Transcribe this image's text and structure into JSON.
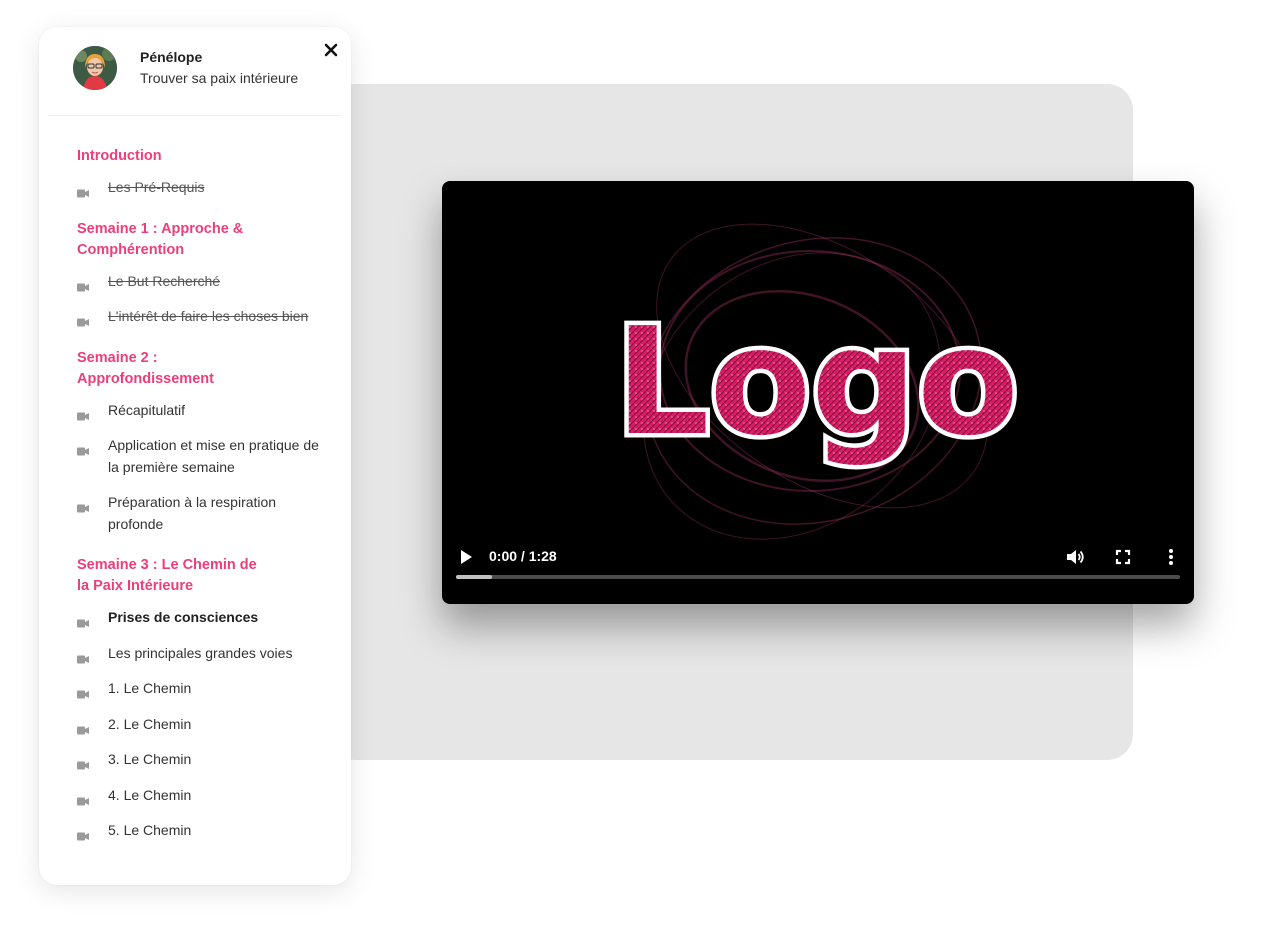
{
  "user": {
    "name": "Pénélope",
    "course_title": "Trouver sa paix intérieure"
  },
  "sections": [
    {
      "title": "Introduction",
      "lessons": [
        {
          "label": "Les Pré-Requis",
          "state": "done"
        }
      ]
    },
    {
      "title": "Semaine 1 : Approche & Comphérention",
      "lessons": [
        {
          "label": "Le But Recherché",
          "state": "done"
        },
        {
          "label": "L'intérêt de faire les choses bien",
          "state": "done"
        }
      ]
    },
    {
      "title": "Semaine 2 : Approfondissement",
      "lessons": [
        {
          "label": "Récapitulatif",
          "state": "normal"
        },
        {
          "label": "Application et mise en pratique de la première semaine",
          "state": "normal"
        },
        {
          "label": "Préparation à la respiration profonde",
          "state": "normal"
        }
      ]
    },
    {
      "title": "Semaine 3 : Le Chemin de la Paix Intérieure",
      "lessons": [
        {
          "label": "Prises de consciences",
          "state": "current"
        },
        {
          "label": "Les principales grandes voies",
          "state": "normal"
        },
        {
          "label": "1. Le Chemin",
          "state": "normal"
        },
        {
          "label": "2. Le Chemin",
          "state": "normal"
        },
        {
          "label": "3. Le Chemin",
          "state": "normal"
        },
        {
          "label": "4. Le Chemin",
          "state": "normal"
        },
        {
          "label": "5. Le Chemin",
          "state": "normal"
        }
      ]
    }
  ],
  "player": {
    "logo_text": "Logo",
    "time_display": "0:00 / 1:28",
    "buffered_fraction": 0.05
  },
  "colors": {
    "accent": "#ec3f7a",
    "logo_pink": "#d81d66",
    "video_bg": "#000000"
  },
  "icons": {
    "close": "close-icon",
    "lesson": "video-camera-icon",
    "play": "play-icon",
    "volume": "volume-icon",
    "fullscreen": "fullscreen-icon",
    "more": "more-vert-icon"
  }
}
